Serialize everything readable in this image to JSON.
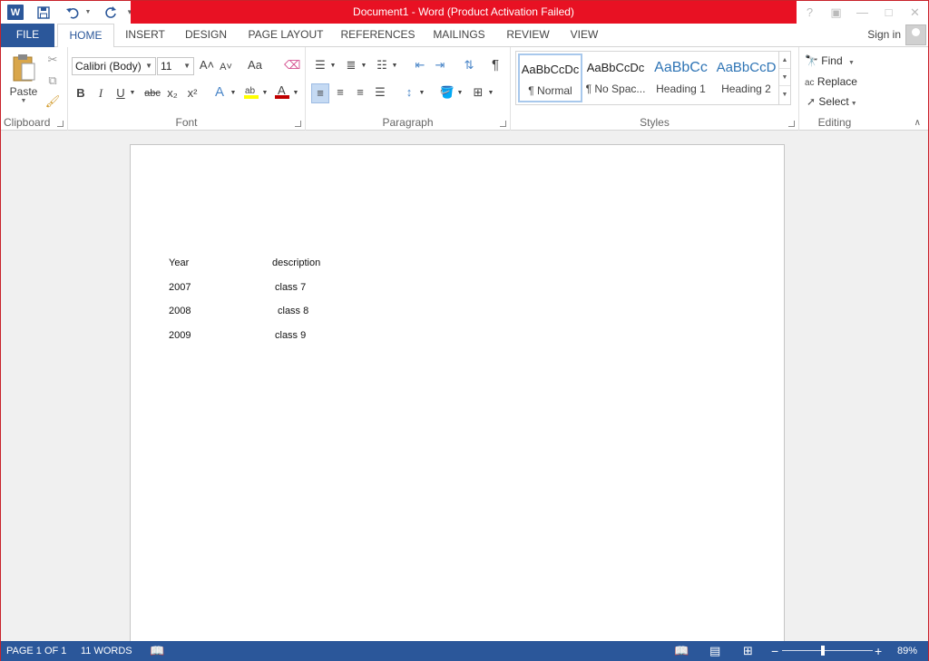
{
  "window": {
    "title": "Document1 - Word (Product Activation Failed)",
    "controls": [
      "?",
      "▣",
      "—",
      "□",
      "✕"
    ]
  },
  "qat": {
    "word_logo": "W",
    "save_icon": "save-icon",
    "undo_icon": "undo-icon",
    "redo_icon": "redo-icon"
  },
  "tabs": {
    "file": "FILE",
    "items": [
      "HOME",
      "INSERT",
      "DESIGN",
      "PAGE LAYOUT",
      "REFERENCES",
      "MAILINGS",
      "REVIEW",
      "VIEW"
    ],
    "active": "HOME",
    "sign_in": "Sign in"
  },
  "ribbon": {
    "clipboard": {
      "label": "Clipboard",
      "paste": "Paste"
    },
    "font": {
      "label": "Font",
      "font_name": "Calibri (Body)",
      "font_size": "11",
      "bold": "B",
      "italic": "I",
      "underline": "U",
      "strike": "abc",
      "subscript": "x₂",
      "superscript": "x²",
      "grow": "A˄",
      "shrink": "A˅",
      "case": "Aa"
    },
    "paragraph": {
      "label": "Paragraph",
      "pilcrow": "¶"
    },
    "styles": {
      "label": "Styles",
      "items": [
        {
          "preview": "AaBbCcDc",
          "name": "¶ Normal"
        },
        {
          "preview": "AaBbCcDc",
          "name": "¶ No Spac..."
        },
        {
          "preview": "AaBbCc",
          "name": "Heading 1"
        },
        {
          "preview": "AaBbCcD",
          "name": "Heading 2"
        }
      ]
    },
    "editing": {
      "label": "Editing",
      "find": "Find",
      "replace": "Replace",
      "select": "Select"
    }
  },
  "document": {
    "rows": [
      {
        "year": "Year",
        "description": "description"
      },
      {
        "year": "2007",
        "description": "class 7"
      },
      {
        "year": "2008",
        "description": "class 8"
      },
      {
        "year": "2009",
        "description": "class 9"
      }
    ]
  },
  "status": {
    "page": "PAGE 1 OF 1",
    "words": "11 WORDS",
    "zoom": "89%",
    "zoom_level": 0.89
  },
  "colors": {
    "accent": "#2b579a",
    "title_warning": "#e81123"
  }
}
